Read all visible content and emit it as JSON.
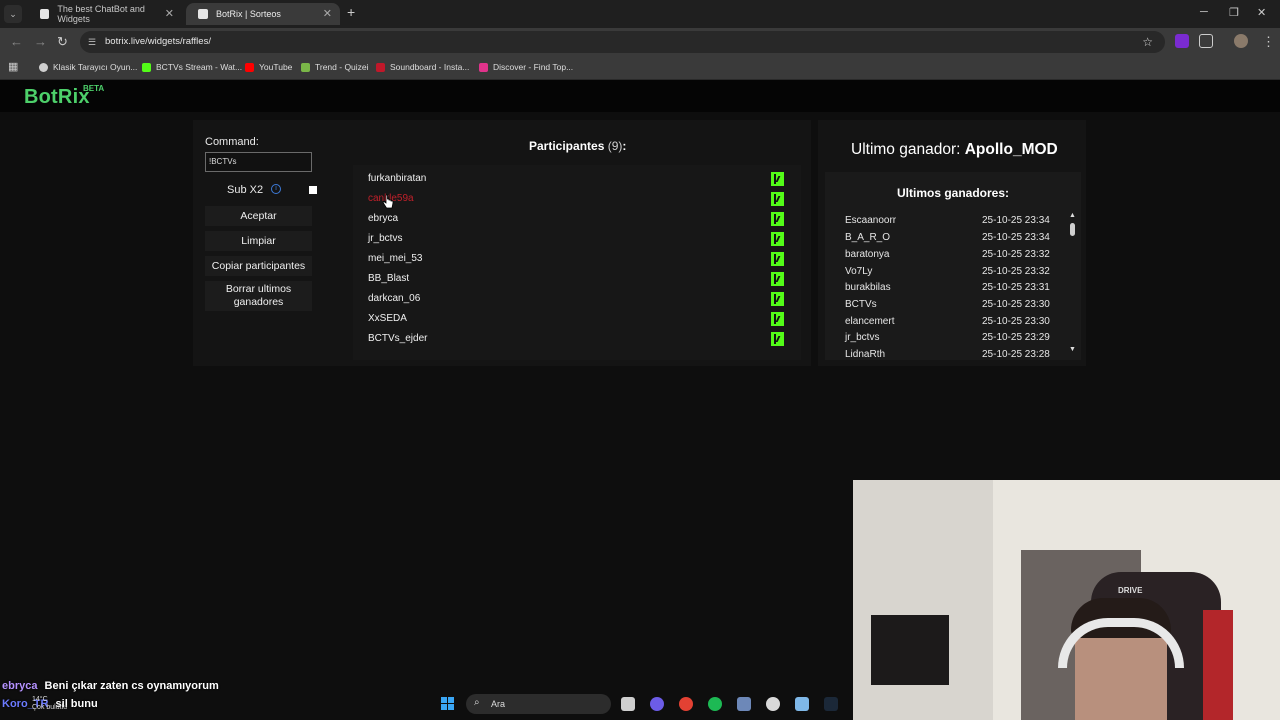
{
  "browser": {
    "tabs": [
      {
        "title": "The best ChatBot and Widgets",
        "active": false
      },
      {
        "title": "BotRix | Sorteos",
        "active": true
      }
    ],
    "url": "botrix.live/widgets/raffles/",
    "bookmarks": [
      {
        "label": "Klasik Tarayıcı Oyun...",
        "color": "#cfcfcf"
      },
      {
        "label": "BCTVs Stream - Wat...",
        "color": "#53fc18"
      },
      {
        "label": "YouTube",
        "color": "#ff0000"
      },
      {
        "label": "Trend - Quizei",
        "color": "#7ab648"
      },
      {
        "label": "Soundboard - Insta...",
        "color": "#c0182a"
      },
      {
        "label": "Discover - Find Top...",
        "color": "#e0338b"
      }
    ]
  },
  "app": {
    "logo": "BotRix",
    "beta": "BETA",
    "accent": "#4dd06a"
  },
  "raffle": {
    "command_label": "Command:",
    "command_value": "!BCTVs",
    "sub_label": "Sub X2",
    "buttons": {
      "accept": "Aceptar",
      "clear": "Limpiar",
      "copy": "Copiar participantes",
      "delete_winners": "Borrar ultimos ganadores"
    },
    "participants_title": "Participantes",
    "participants_count": "(9)",
    "participants_suffix": ":",
    "participants": [
      {
        "name": "furkanbiratan",
        "highlight": false
      },
      {
        "name": "cankle59a",
        "highlight": true
      },
      {
        "name": "ebryca",
        "highlight": false
      },
      {
        "name": "jr_bctvs",
        "highlight": false
      },
      {
        "name": "mei_mei_53",
        "highlight": false
      },
      {
        "name": "BB_Blast",
        "highlight": false
      },
      {
        "name": "darkcan_06",
        "highlight": false
      },
      {
        "name": "XxSEDA",
        "highlight": false
      },
      {
        "name": "BCTVs_ejder",
        "highlight": false
      }
    ]
  },
  "winners": {
    "last_label": "Ultimo ganador:",
    "last_name": "Apollo_MOD",
    "list_title": "Ultimos ganadores:",
    "list": [
      {
        "name": "Escaanoorr",
        "date": "25-10-25 23:34"
      },
      {
        "name": "B_A_R_O",
        "date": "25-10-25 23:34"
      },
      {
        "name": "baratonya",
        "date": "25-10-25 23:32"
      },
      {
        "name": "Vo7Ly",
        "date": "25-10-25 23:32"
      },
      {
        "name": "burakbilas",
        "date": "25-10-25 23:31"
      },
      {
        "name": "BCTVs",
        "date": "25-10-25 23:30"
      },
      {
        "name": "elancemert",
        "date": "25-10-25 23:30"
      },
      {
        "name": "jr_bctvs",
        "date": "25-10-25 23:29"
      },
      {
        "name": "LidnaRth",
        "date": "25-10-25 23:28"
      }
    ]
  },
  "chat": [
    {
      "user": "ebryca",
      "message": "Beni çıkar zaten cs oynamıyorum"
    },
    {
      "user": "Koro_TR",
      "message": "sil bunu"
    }
  ],
  "webcam": {
    "brand": "DRIVE"
  },
  "taskbar": {
    "weather_temp": "14°C",
    "weather_desc": "Çok bulutlu",
    "search_placeholder": "Ara"
  }
}
